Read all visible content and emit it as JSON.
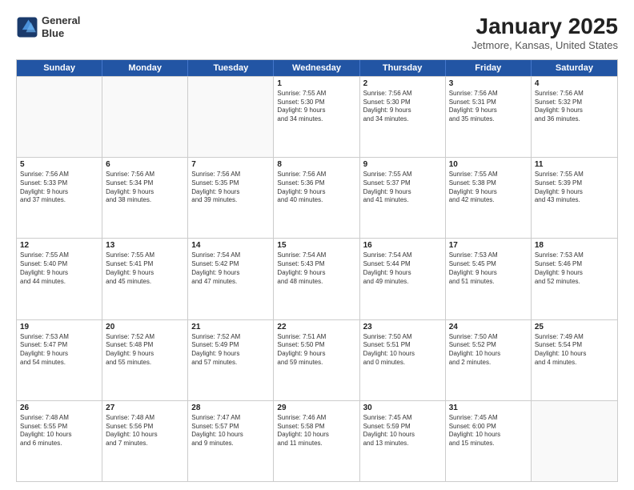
{
  "header": {
    "logo_line1": "General",
    "logo_line2": "Blue",
    "month": "January 2025",
    "location": "Jetmore, Kansas, United States"
  },
  "days_of_week": [
    "Sunday",
    "Monday",
    "Tuesday",
    "Wednesday",
    "Thursday",
    "Friday",
    "Saturday"
  ],
  "weeks": [
    [
      {
        "day": "",
        "info": ""
      },
      {
        "day": "",
        "info": ""
      },
      {
        "day": "",
        "info": ""
      },
      {
        "day": "1",
        "info": "Sunrise: 7:55 AM\nSunset: 5:30 PM\nDaylight: 9 hours\nand 34 minutes."
      },
      {
        "day": "2",
        "info": "Sunrise: 7:56 AM\nSunset: 5:30 PM\nDaylight: 9 hours\nand 34 minutes."
      },
      {
        "day": "3",
        "info": "Sunrise: 7:56 AM\nSunset: 5:31 PM\nDaylight: 9 hours\nand 35 minutes."
      },
      {
        "day": "4",
        "info": "Sunrise: 7:56 AM\nSunset: 5:32 PM\nDaylight: 9 hours\nand 36 minutes."
      }
    ],
    [
      {
        "day": "5",
        "info": "Sunrise: 7:56 AM\nSunset: 5:33 PM\nDaylight: 9 hours\nand 37 minutes."
      },
      {
        "day": "6",
        "info": "Sunrise: 7:56 AM\nSunset: 5:34 PM\nDaylight: 9 hours\nand 38 minutes."
      },
      {
        "day": "7",
        "info": "Sunrise: 7:56 AM\nSunset: 5:35 PM\nDaylight: 9 hours\nand 39 minutes."
      },
      {
        "day": "8",
        "info": "Sunrise: 7:56 AM\nSunset: 5:36 PM\nDaylight: 9 hours\nand 40 minutes."
      },
      {
        "day": "9",
        "info": "Sunrise: 7:55 AM\nSunset: 5:37 PM\nDaylight: 9 hours\nand 41 minutes."
      },
      {
        "day": "10",
        "info": "Sunrise: 7:55 AM\nSunset: 5:38 PM\nDaylight: 9 hours\nand 42 minutes."
      },
      {
        "day": "11",
        "info": "Sunrise: 7:55 AM\nSunset: 5:39 PM\nDaylight: 9 hours\nand 43 minutes."
      }
    ],
    [
      {
        "day": "12",
        "info": "Sunrise: 7:55 AM\nSunset: 5:40 PM\nDaylight: 9 hours\nand 44 minutes."
      },
      {
        "day": "13",
        "info": "Sunrise: 7:55 AM\nSunset: 5:41 PM\nDaylight: 9 hours\nand 45 minutes."
      },
      {
        "day": "14",
        "info": "Sunrise: 7:54 AM\nSunset: 5:42 PM\nDaylight: 9 hours\nand 47 minutes."
      },
      {
        "day": "15",
        "info": "Sunrise: 7:54 AM\nSunset: 5:43 PM\nDaylight: 9 hours\nand 48 minutes."
      },
      {
        "day": "16",
        "info": "Sunrise: 7:54 AM\nSunset: 5:44 PM\nDaylight: 9 hours\nand 49 minutes."
      },
      {
        "day": "17",
        "info": "Sunrise: 7:53 AM\nSunset: 5:45 PM\nDaylight: 9 hours\nand 51 minutes."
      },
      {
        "day": "18",
        "info": "Sunrise: 7:53 AM\nSunset: 5:46 PM\nDaylight: 9 hours\nand 52 minutes."
      }
    ],
    [
      {
        "day": "19",
        "info": "Sunrise: 7:53 AM\nSunset: 5:47 PM\nDaylight: 9 hours\nand 54 minutes."
      },
      {
        "day": "20",
        "info": "Sunrise: 7:52 AM\nSunset: 5:48 PM\nDaylight: 9 hours\nand 55 minutes."
      },
      {
        "day": "21",
        "info": "Sunrise: 7:52 AM\nSunset: 5:49 PM\nDaylight: 9 hours\nand 57 minutes."
      },
      {
        "day": "22",
        "info": "Sunrise: 7:51 AM\nSunset: 5:50 PM\nDaylight: 9 hours\nand 59 minutes."
      },
      {
        "day": "23",
        "info": "Sunrise: 7:50 AM\nSunset: 5:51 PM\nDaylight: 10 hours\nand 0 minutes."
      },
      {
        "day": "24",
        "info": "Sunrise: 7:50 AM\nSunset: 5:52 PM\nDaylight: 10 hours\nand 2 minutes."
      },
      {
        "day": "25",
        "info": "Sunrise: 7:49 AM\nSunset: 5:54 PM\nDaylight: 10 hours\nand 4 minutes."
      }
    ],
    [
      {
        "day": "26",
        "info": "Sunrise: 7:48 AM\nSunset: 5:55 PM\nDaylight: 10 hours\nand 6 minutes."
      },
      {
        "day": "27",
        "info": "Sunrise: 7:48 AM\nSunset: 5:56 PM\nDaylight: 10 hours\nand 7 minutes."
      },
      {
        "day": "28",
        "info": "Sunrise: 7:47 AM\nSunset: 5:57 PM\nDaylight: 10 hours\nand 9 minutes."
      },
      {
        "day": "29",
        "info": "Sunrise: 7:46 AM\nSunset: 5:58 PM\nDaylight: 10 hours\nand 11 minutes."
      },
      {
        "day": "30",
        "info": "Sunrise: 7:45 AM\nSunset: 5:59 PM\nDaylight: 10 hours\nand 13 minutes."
      },
      {
        "day": "31",
        "info": "Sunrise: 7:45 AM\nSunset: 6:00 PM\nDaylight: 10 hours\nand 15 minutes."
      },
      {
        "day": "",
        "info": ""
      }
    ]
  ]
}
